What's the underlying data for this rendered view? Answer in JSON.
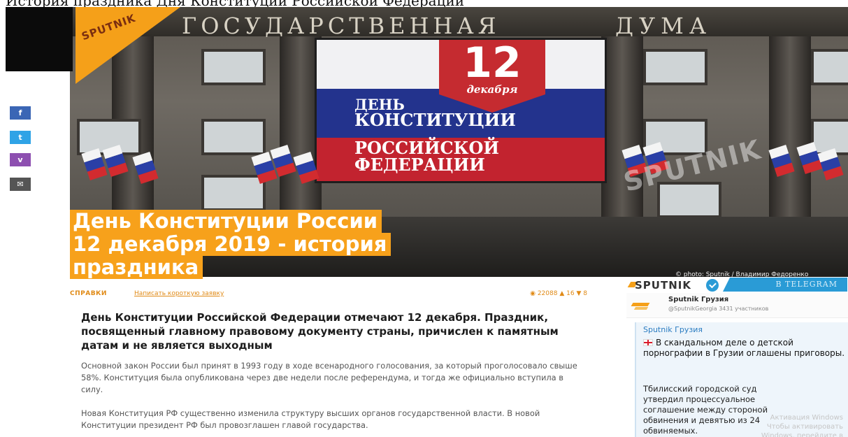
{
  "page": {
    "caption": "История праздника Дня Конституции Российской Федерации"
  },
  "share": {
    "facebook": "f",
    "twitter": "t",
    "viber": "v",
    "email": "✉"
  },
  "hero": {
    "duma_sign_left": "ГОСУДАРСТВЕННАЯ",
    "duma_sign_right": "ДУМА",
    "logo_text": "SPUTNIK",
    "watermark": "SPUTNIK",
    "banner": {
      "day_number": "12",
      "month": "декабря",
      "line1": "ДЕНЬ",
      "line2": "КОНСТИТУЦИИ",
      "line3": "РОССИЙСКОЙ",
      "line4": "ФЕДЕРАЦИИ"
    },
    "title_lines": [
      "День Конституции России",
      "12 декабря 2019 - история",
      "праздника"
    ],
    "photo_credit": "© photo: Sputnik / Владимир Федоренко"
  },
  "article": {
    "category": "СПРАВКИ",
    "related_link": "Написать короткую заявку",
    "views": "22088",
    "likes": "16",
    "dislikes": "8",
    "lead": "День Конституции Российской Федерации отмечают 12 декабря. Праздник, посвященный главному правовому документу страны, причислен к памятным датам и не является выходным",
    "paragraph1": "Основной закон России был принят в 1993 году в ходе всенародного голосования, за который проголосовало свыше 58%. Конституция была опубликована через две недели после референдума, и тогда же официально вступила в силу.",
    "paragraph2": "Новая Конституция РФ существенно изменила структуру высших органов государственной власти. В новой Конституции президент РФ был провозглашен главой государства."
  },
  "widget": {
    "brand": "SPUTNIK",
    "telegram_tab": "В TELEGRAM",
    "channel_name": "Sputnik Грузия",
    "channel_sub": "@SputnikGeorgia 3431 участников",
    "post_author": "Sputnik Грузия",
    "post_headline": "В скандальном деле о детской порнографии в Грузии оглашены приговоры.",
    "post_body": "Тбилисский городской суд утвердил процессуальное соглашение между стороной обвинения и девятью из 24 обвиняемых.",
    "post_fade": "Активация Windows Чтобы активировать Windows, перейдите в раздел Параметры"
  },
  "colors": {
    "accent_orange": "#f7a11b",
    "facebook": "#3b66b5",
    "twitter": "#2fa3e6",
    "viber": "#8d4fb0",
    "email": "#555555",
    "telegram": "#2a9bd6"
  }
}
